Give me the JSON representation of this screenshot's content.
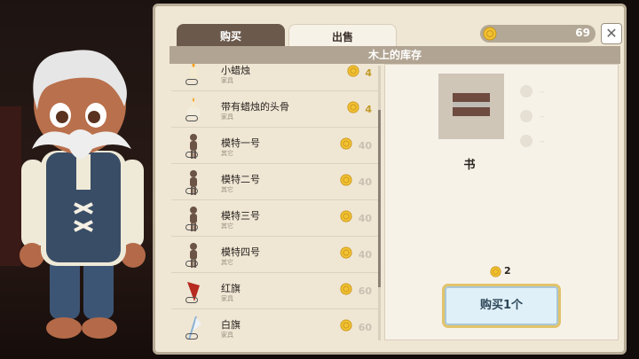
{
  "tabs": {
    "buy": "购买",
    "sell": "出售"
  },
  "wallet": {
    "coins": "69"
  },
  "close_label": "✕",
  "stock_header": "木上的库存",
  "items": [
    {
      "name": "小蜡烛",
      "category": "家具",
      "price": "4",
      "affordable": true,
      "icon": "candle-icon"
    },
    {
      "name": "带有蜡烛的头骨",
      "category": "家具",
      "price": "4",
      "affordable": true,
      "icon": "skull-candle-icon"
    },
    {
      "name": "模特一号",
      "category": "其它",
      "price": "40",
      "affordable": false,
      "icon": "mannequin-icon"
    },
    {
      "name": "模特二号",
      "category": "其它",
      "price": "40",
      "affordable": false,
      "icon": "mannequin-icon"
    },
    {
      "name": "模特三号",
      "category": "其它",
      "price": "40",
      "affordable": false,
      "icon": "mannequin-icon"
    },
    {
      "name": "模特四号",
      "category": "其它",
      "price": "40",
      "affordable": false,
      "icon": "mannequin-icon"
    },
    {
      "name": "红旗",
      "category": "家具",
      "price": "60",
      "affordable": false,
      "icon": "red-flag-icon"
    },
    {
      "name": "白旗",
      "category": "家具",
      "price": "60",
      "affordable": false,
      "icon": "white-flag-icon"
    }
  ],
  "detail": {
    "name": "书",
    "cost": "2",
    "attributes": [
      "--",
      "--",
      "--"
    ],
    "buy_button": "购买1个"
  },
  "colors": {
    "coin": "#f2c232",
    "panel": "#efe6d4",
    "header": "#b1a492",
    "accent": "#e1c36a"
  }
}
